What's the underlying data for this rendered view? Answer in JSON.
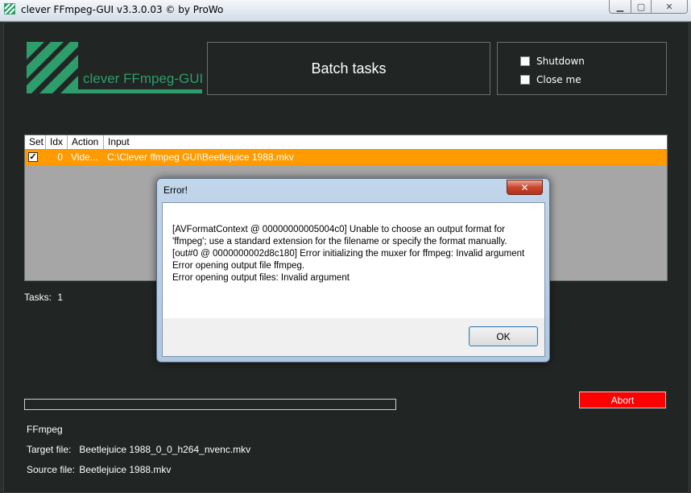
{
  "window": {
    "title": "clever FFmpeg-GUI v3.3.0.03   © by ProWo"
  },
  "logo": {
    "text": "clever FFmpeg-GUI"
  },
  "header": {
    "batch_label": "Batch tasks"
  },
  "options": {
    "shutdown_label": "Shutdown",
    "close_me_label": "Close me"
  },
  "table": {
    "columns": [
      "Set",
      "Idx",
      "Action",
      "Input"
    ],
    "rows": [
      {
        "set_mark": "✓",
        "idx": "0",
        "action": "Vide...",
        "input": "C:\\Clever ffmpeg GUI\\Beetlejuice 1988.mkv"
      }
    ]
  },
  "tasks": {
    "label": "Tasks:",
    "count": "1"
  },
  "buttons": {
    "abort_label": "Abort"
  },
  "info": {
    "tool": "FFmpeg",
    "target_label": "Target file:",
    "target_value": "Beetlejuice 1988_0_0_h264_nvenc.mkv",
    "source_label": "Source file:",
    "source_value": "Beetlejuice 1988.mkv"
  },
  "dialog": {
    "title": "Error!",
    "message": "[AVFormatContext @ 00000000005004c0] Unable to choose an output format for 'ffmpeg'; use a standard extension for the filename or specify the format manually.[out#0 @ 0000000002d8c180] Error initializing the muxer for ffmpeg: Invalid argument\nError opening output file ffmpeg.\nError opening output files: Invalid argument",
    "ok_label": "OK"
  },
  "colors": {
    "accent": "#2e9d6c",
    "selected_row": "#ff9a00",
    "abort": "#ff0000"
  }
}
